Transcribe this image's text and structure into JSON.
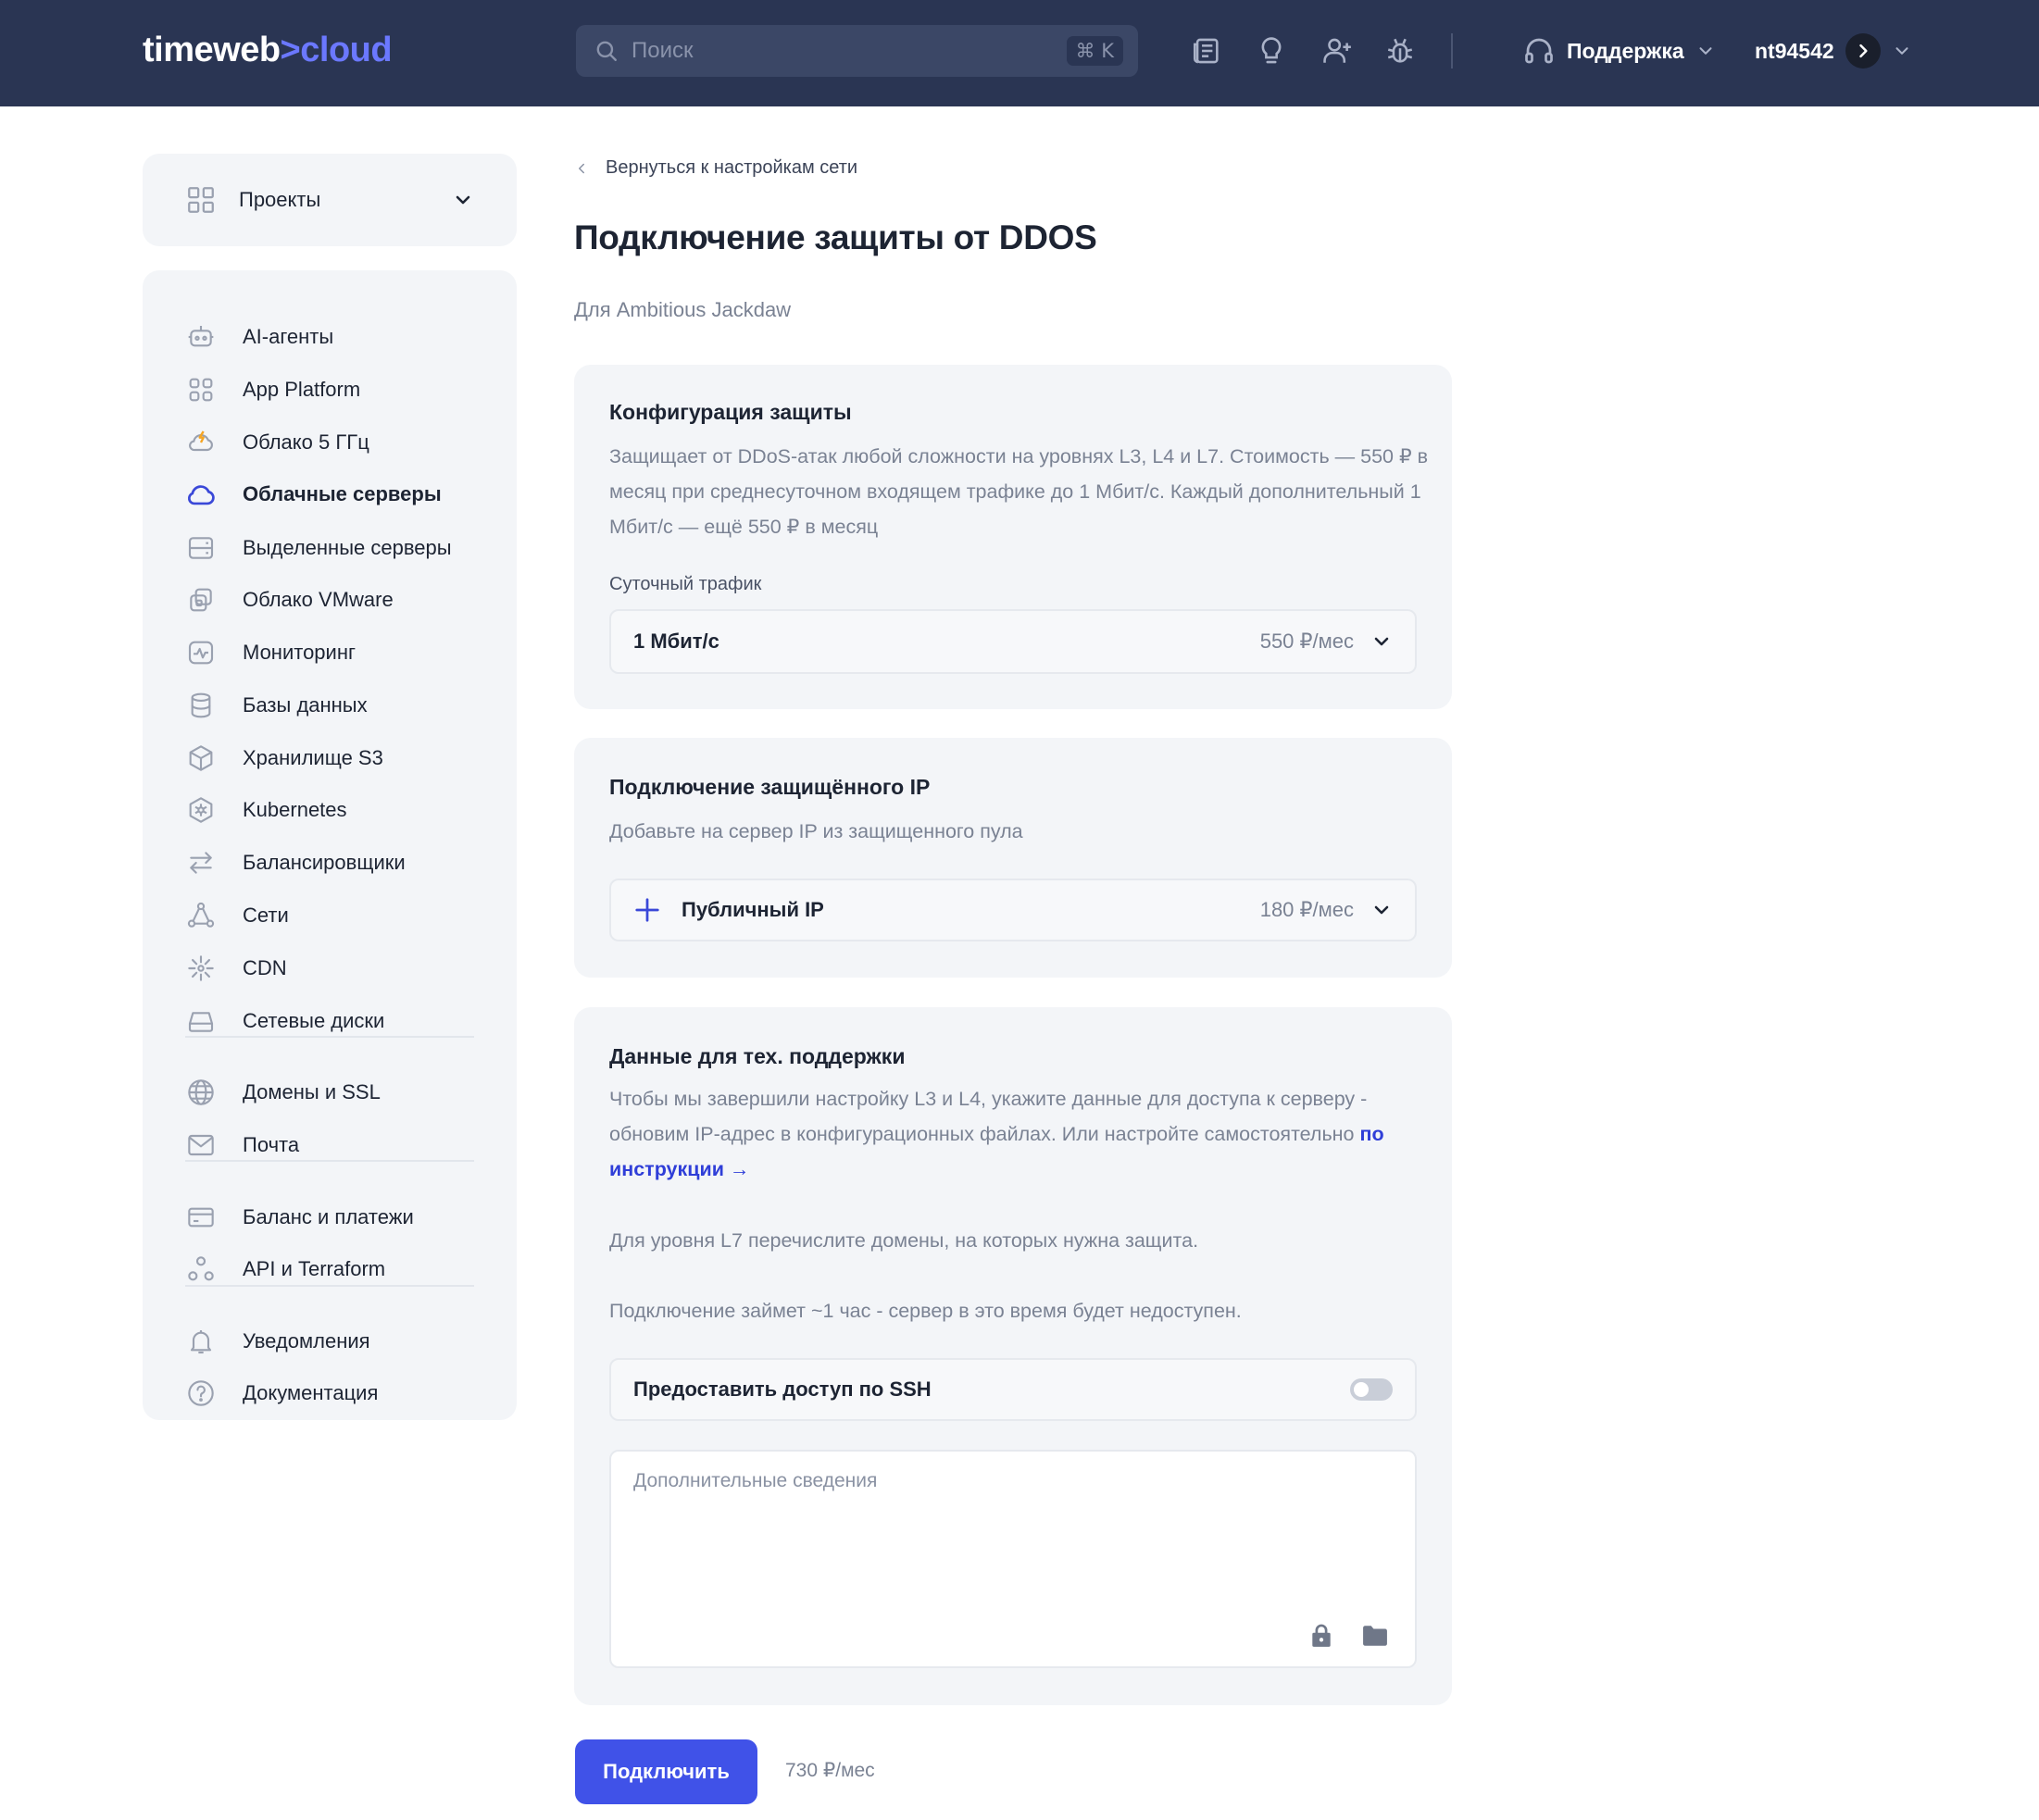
{
  "header": {
    "logo_main": "timeweb",
    "logo_sep": ">",
    "logo_accent": "cloud",
    "search_placeholder": "Поиск",
    "search_shortcut": "⌘ K",
    "support_label": "Поддержка",
    "account_name": "nt94542"
  },
  "sidebar": {
    "projects_label": "Проекты",
    "items": [
      {
        "label": "AI-агенты",
        "icon": "robot-icon"
      },
      {
        "label": "App Platform",
        "icon": "app-grid-icon"
      },
      {
        "label": "Облако 5 ГГц",
        "icon": "cloud-bolt-icon"
      },
      {
        "label": "Облачные серверы",
        "icon": "cloud-icon"
      },
      {
        "label": "Выделенные серверы",
        "icon": "server-icon"
      },
      {
        "label": "Облако VMware",
        "icon": "vmware-icon"
      },
      {
        "label": "Мониторинг",
        "icon": "monitoring-icon"
      },
      {
        "label": "Базы данных",
        "icon": "database-icon"
      },
      {
        "label": "Хранилище S3",
        "icon": "storage-cube-icon"
      },
      {
        "label": "Kubernetes",
        "icon": "kubernetes-icon"
      },
      {
        "label": "Балансировщики",
        "icon": "balancer-arrows-icon"
      },
      {
        "label": "Сети",
        "icon": "network-icon"
      },
      {
        "label": "CDN",
        "icon": "cdn-icon"
      },
      {
        "label": "Сетевые диски",
        "icon": "disk-icon"
      },
      {
        "label": "Домены и SSL",
        "icon": "globe-icon"
      },
      {
        "label": "Почта",
        "icon": "mail-icon"
      },
      {
        "label": "Баланс и платежи",
        "icon": "card-icon"
      },
      {
        "label": "API и Terraform",
        "icon": "api-icon"
      },
      {
        "label": "Уведомления",
        "icon": "bell-icon"
      },
      {
        "label": "Документация",
        "icon": "help-icon"
      }
    ]
  },
  "page": {
    "back_label": "Вернуться к настройкам сети",
    "title": "Подключение защиты от DDOS",
    "subtitle": "Для Ambitious Jackdaw"
  },
  "config": {
    "title": "Конфигурация защиты",
    "description": "Защищает от DDoS-атак любой сложности на уровнях L3, L4 и L7. Стоимость — 550 ₽ в месяц при среднесуточном входящем трафике до 1 Мбит/с. Каждый дополнительный 1 Мбит/с — ещё 550 ₽ в месяц",
    "traffic_label": "Суточный трафик",
    "traffic_value": "1 Мбит/с",
    "traffic_price": "550 ₽/мес"
  },
  "ip": {
    "title": "Подключение защищённого IP",
    "description": "Добавьте на сервер IP из защищенного пула",
    "select_value": "Публичный IP",
    "select_price": "180 ₽/мес"
  },
  "support_data": {
    "title": "Данные для тех. поддержки",
    "text1": "Чтобы мы завершили настройку L3 и L4, укажите данные для доступа к серверу - обновим IP-адрес в конфигурационных файлах. Или настройте самостоятельно",
    "link_label": "по инструкции →",
    "text2": "Для уровня L7 перечислите домены, на которых нужна защита.",
    "text3": "Подключение займет ~1 час - сервер в это время будет недоступен.",
    "ssh_label": "Предоставить доступ по SSH",
    "notes_placeholder": "Дополнительные сведения"
  },
  "footer": {
    "submit_label": "Подключить",
    "total_price": "730 ₽/мес"
  }
}
